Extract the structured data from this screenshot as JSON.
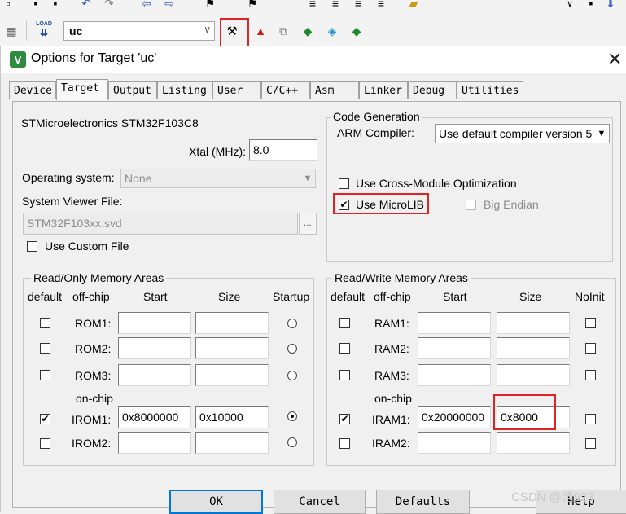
{
  "toolbar": {
    "target_name": "uc",
    "load_icon_label": "LOAD"
  },
  "dialog": {
    "title": "Options for Target 'uc'",
    "tabs": [
      "Device",
      "Target",
      "Output",
      "Listing",
      "User",
      "C/C++",
      "Asm",
      "Linker",
      "Debug",
      "Utilities"
    ],
    "active_tab": "Target"
  },
  "target": {
    "device_name": "STMicroelectronics STM32F103C8",
    "xtal_label": "Xtal (MHz):",
    "xtal_value": "8.0",
    "os_label": "Operating system:",
    "os_value": "None",
    "svd_label": "System Viewer File:",
    "svd_value": "STM32F103xx.svd",
    "svd_browse": "...",
    "custom_file_label": "Use Custom File"
  },
  "codegen": {
    "group_label": "Code Generation",
    "compiler_label": "ARM Compiler:",
    "compiler_value": "Use default compiler version 5",
    "cross_module_label": "Use Cross-Module Optimization",
    "microlib_label": "Use MicroLIB",
    "big_endian_label": "Big Endian"
  },
  "rom_area": {
    "group_label": "Read/Only Memory Areas",
    "headers": {
      "default": "default",
      "offchip": "off-chip",
      "start": "Start",
      "size": "Size",
      "startup": "Startup"
    },
    "onchip_label": "on-chip",
    "rows": [
      {
        "name": "ROM1:",
        "start": "",
        "size": "",
        "default": false,
        "startup": false
      },
      {
        "name": "ROM2:",
        "start": "",
        "size": "",
        "default": false,
        "startup": false
      },
      {
        "name": "ROM3:",
        "start": "",
        "size": "",
        "default": false,
        "startup": false
      },
      {
        "name": "IROM1:",
        "start": "0x8000000",
        "size": "0x10000",
        "default": true,
        "startup": true
      },
      {
        "name": "IROM2:",
        "start": "",
        "size": "",
        "default": false,
        "startup": false
      }
    ]
  },
  "ram_area": {
    "group_label": "Read/Write Memory Areas",
    "headers": {
      "default": "default",
      "offchip": "off-chip",
      "start": "Start",
      "size": "Size",
      "noinit": "NoInit"
    },
    "onchip_label": "on-chip",
    "rows": [
      {
        "name": "RAM1:",
        "start": "",
        "size": "",
        "default": false,
        "noinit": false
      },
      {
        "name": "RAM2:",
        "start": "",
        "size": "",
        "default": false,
        "noinit": false
      },
      {
        "name": "RAM3:",
        "start": "",
        "size": "",
        "default": false,
        "noinit": false
      },
      {
        "name": "IRAM1:",
        "start": "0x20000000",
        "size": "0x8000",
        "default": true,
        "noinit": false
      },
      {
        "name": "IRAM2:",
        "start": "",
        "size": "",
        "default": false,
        "noinit": false
      }
    ]
  },
  "buttons": {
    "ok": "OK",
    "cancel": "Cancel",
    "defaults": "Defaults",
    "help": "Help"
  },
  "watermark": "CSDN @浩923",
  "colors": {
    "highlight": "#e02424",
    "focus": "#0078d7"
  }
}
